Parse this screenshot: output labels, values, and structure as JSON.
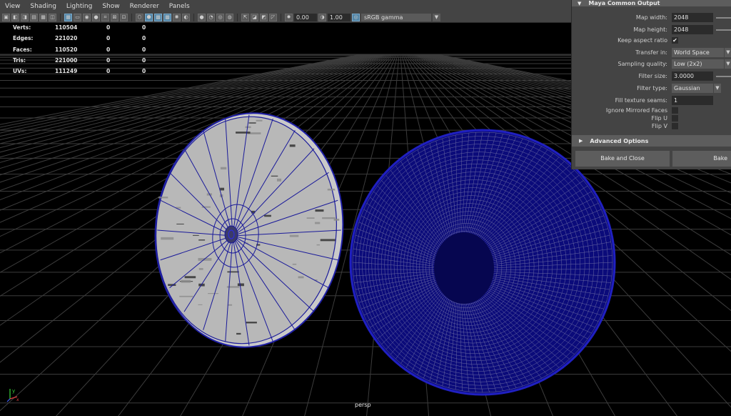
{
  "menubar": {
    "items": [
      "View",
      "Shading",
      "Lighting",
      "Show",
      "Renderer",
      "Panels"
    ]
  },
  "toolbar": {
    "exposure": "0.00",
    "gamma": "1.00",
    "color_space": "sRGB gamma"
  },
  "hud": {
    "rows": [
      {
        "label": "Verts:",
        "v1": "110504",
        "v2": "0",
        "v3": "0"
      },
      {
        "label": "Edges:",
        "v1": "221020",
        "v2": "0",
        "v3": "0"
      },
      {
        "label": "Faces:",
        "v1": "110520",
        "v2": "0",
        "v3": "0"
      },
      {
        "label": "Tris:",
        "v1": "221000",
        "v2": "0",
        "v3": "0"
      },
      {
        "label": "UVs:",
        "v1": "111249",
        "v2": "0",
        "v3": "0"
      }
    ]
  },
  "viewport": {
    "camera": "persp",
    "axis_y": "y",
    "axis_x": "x"
  },
  "panel": {
    "title": "Maya Common Output",
    "map_width_label": "Map width:",
    "map_width": "2048",
    "map_height_label": "Map height:",
    "map_height": "2048",
    "keep_aspect_label": "Keep aspect ratio",
    "keep_aspect_check": "✔",
    "transfer_in_label": "Transfer in:",
    "transfer_in": "World Space",
    "sampling_label": "Sampling quality:",
    "sampling": "Low (2x2)",
    "filter_size_label": "Filter size:",
    "filter_size": "3.0000",
    "filter_type_label": "Filter type:",
    "filter_type": "Gaussian",
    "fill_seams_label": "Fill texture seams:",
    "fill_seams": "1",
    "ignore_mirrored_label": "Ignore Mirrored Faces",
    "flip_u_label": "Flip U",
    "flip_v_label": "Flip V",
    "advanced_label": "Advanced Options",
    "bake_close_label": "Bake and Close",
    "bake_label": "Bake"
  }
}
